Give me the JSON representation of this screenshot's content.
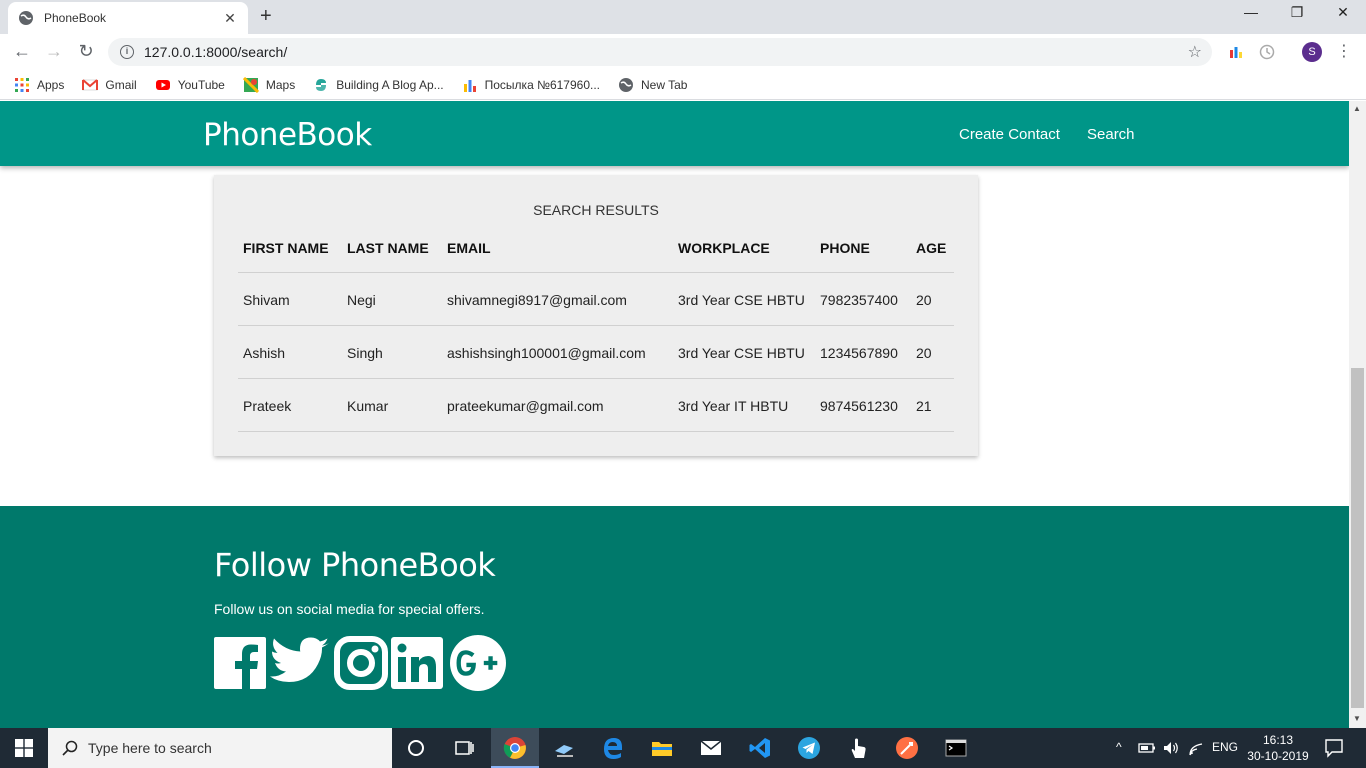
{
  "browser": {
    "tab_title": "PhoneBook",
    "tab_close": "✕",
    "new_tab": "+",
    "window_controls": {
      "minimize": "—",
      "maximize": "❐",
      "close": "✕"
    },
    "url": "127.0.0.1:8000/search/",
    "profile_initial": "S",
    "bookmarks": [
      {
        "label": "Apps",
        "icon": "apps-grid-icon"
      },
      {
        "label": "Gmail",
        "icon": "gmail-icon"
      },
      {
        "label": "YouTube",
        "icon": "youtube-icon"
      },
      {
        "label": "Maps",
        "icon": "maps-icon"
      },
      {
        "label": "Building A Blog Ap...",
        "icon": "python-icon"
      },
      {
        "label": "Посылка №617960...",
        "icon": "bar-chart-icon"
      },
      {
        "label": "New Tab",
        "icon": "globe-icon"
      }
    ]
  },
  "site": {
    "brand": "PhoneBook",
    "nav": {
      "create_contact": "Create Contact",
      "search": "Search"
    },
    "colors": {
      "navbar": "#009688",
      "footer": "#00796b"
    }
  },
  "results": {
    "title": "SEARCH RESULTS",
    "columns": [
      "FIRST NAME",
      "LAST NAME",
      "EMAIL",
      "WORKPLACE",
      "PHONE",
      "AGE"
    ],
    "rows": [
      [
        "Shivam",
        "Negi",
        "shivamnegi8917@gmail.com",
        "3rd Year CSE HBTU",
        "7982357400",
        "20"
      ],
      [
        "Ashish",
        "Singh",
        "ashishsingh100001@gmail.com",
        "3rd Year CSE HBTU",
        "1234567890",
        "20"
      ],
      [
        "Prateek",
        "Kumar",
        "prateekumar@gmail.com",
        "3rd Year IT HBTU",
        "9874561230",
        "21"
      ]
    ]
  },
  "footer": {
    "title": "Follow PhoneBook",
    "text": "Follow us on social media for special offers.",
    "social": [
      "facebook-icon",
      "twitter-icon",
      "instagram-icon",
      "linkedin-icon",
      "google-plus-icon"
    ]
  },
  "taskbar": {
    "search_placeholder": "Type here to search",
    "language": "ENG",
    "time": "16:13",
    "date": "30-10-2019"
  }
}
